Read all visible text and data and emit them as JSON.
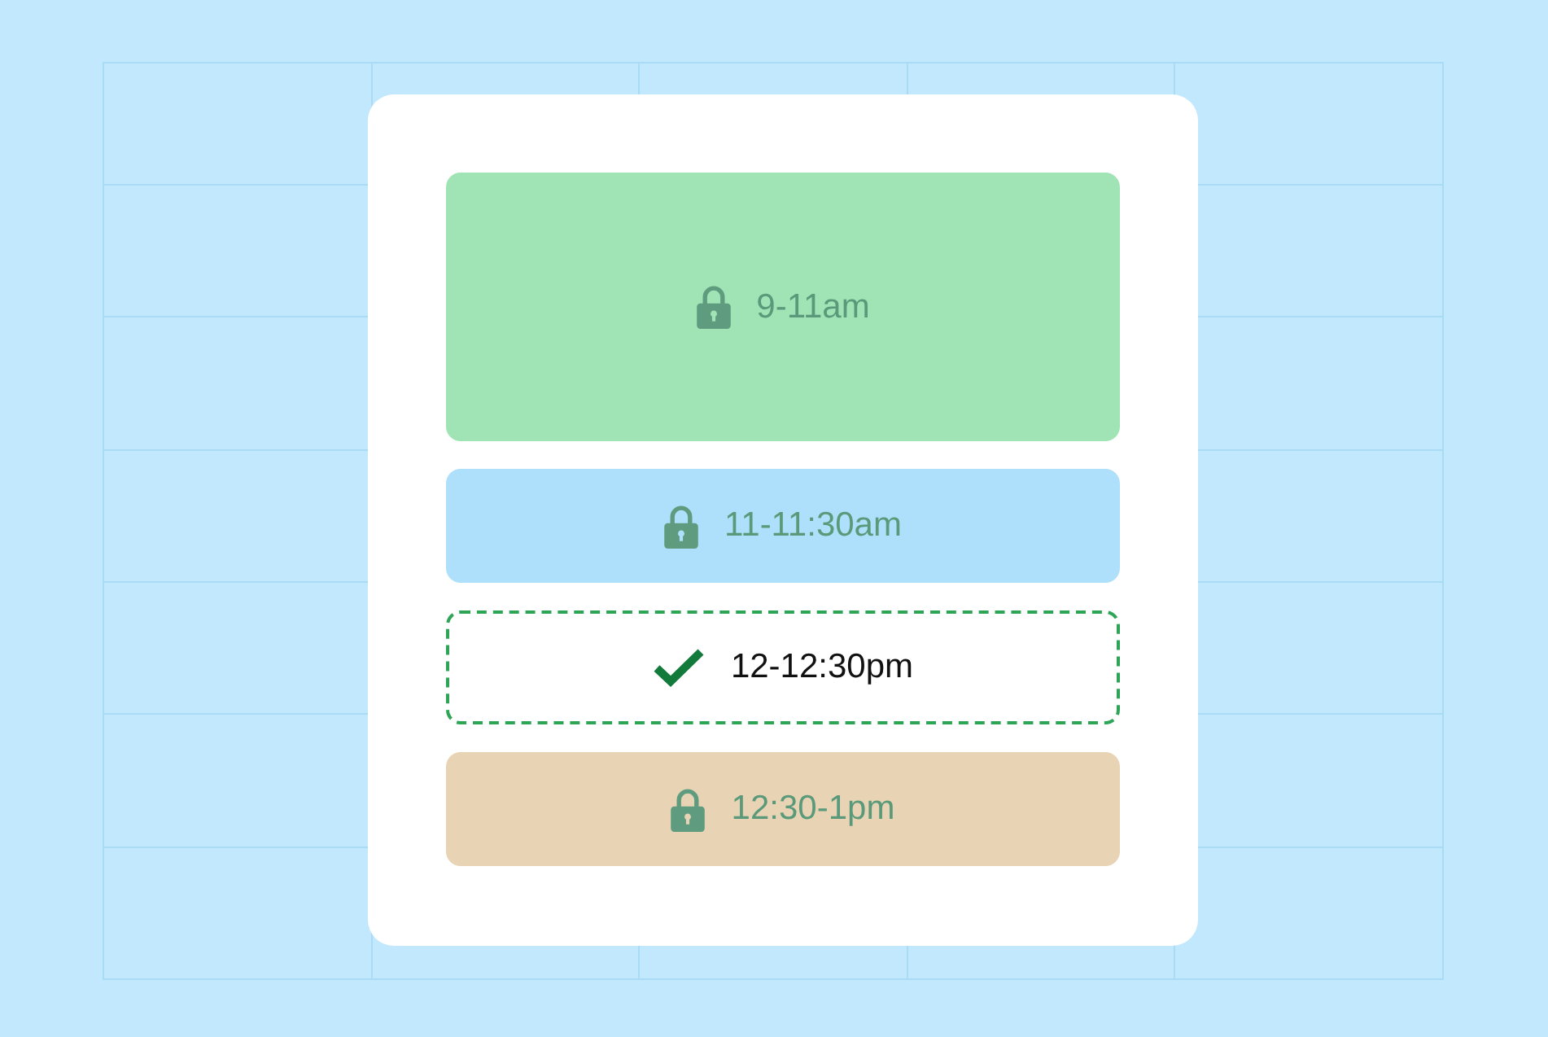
{
  "slots": [
    {
      "time": "9-11am",
      "locked": true,
      "selected": false,
      "color": "#a0e4b6"
    },
    {
      "time": "11-11:30am",
      "locked": true,
      "selected": false,
      "color": "#aee0fb"
    },
    {
      "time": "12-12:30pm",
      "locked": false,
      "selected": true,
      "color": "#ffffff"
    },
    {
      "time": "12:30-1pm",
      "locked": true,
      "selected": false,
      "color": "#e8d4b4"
    }
  ]
}
